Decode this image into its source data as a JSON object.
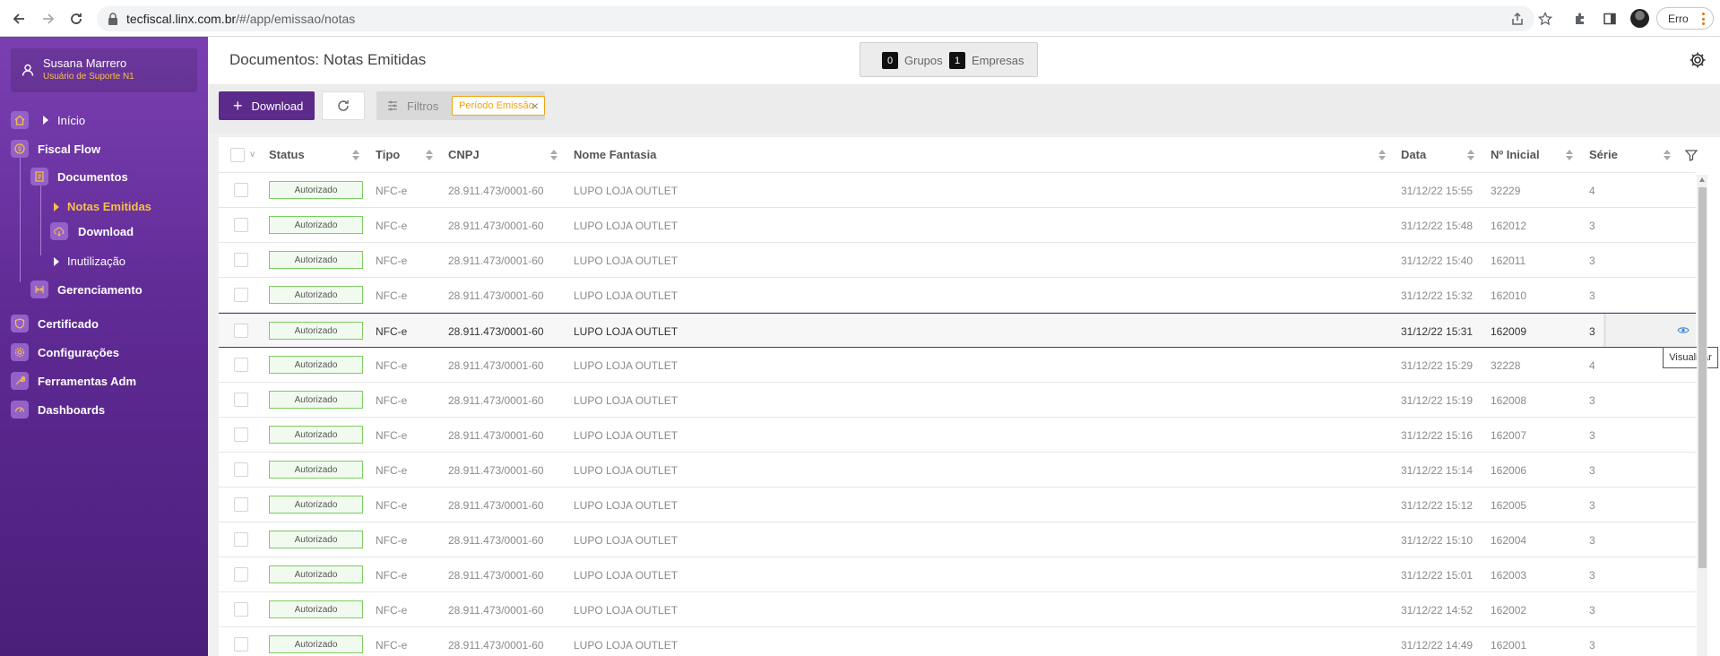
{
  "browser": {
    "url_host": "tecfiscal.linx.com.br",
    "url_path": "/#/app/emissao/notas",
    "profile_button": "Erro"
  },
  "sidebar": {
    "user": {
      "name": "Susana Marrero",
      "role": "Usuário de Suporte N1"
    },
    "items": [
      {
        "label": "Início"
      },
      {
        "label": "Fiscal Flow"
      },
      {
        "label": "Documentos"
      },
      {
        "label": "Notas Emitidas"
      },
      {
        "label": "Download"
      },
      {
        "label": "Inutilização"
      },
      {
        "label": "Gerenciamento"
      },
      {
        "label": "Certificado"
      },
      {
        "label": "Configurações"
      },
      {
        "label": "Ferramentas Adm"
      },
      {
        "label": "Dashboards"
      }
    ],
    "active_color": "#f5c04a",
    "background": "#6a309f"
  },
  "header": {
    "title": "Documentos: Notas Emitidas",
    "grupos_count": "0",
    "grupos_label": "Grupos",
    "empresas_count": "1",
    "empresas_label": "Empresas"
  },
  "toolbar": {
    "download_label": "Download",
    "filters_label": "Filtros",
    "chip_label": "Período Emissão",
    "chip_close": "×"
  },
  "table": {
    "columns": [
      "Status",
      "Tipo",
      "CNPJ",
      "Nome Fantasia",
      "Data",
      "Nº Inicial",
      "Série"
    ],
    "rows": [
      {
        "status": "Autorizado",
        "tipo": "NFC-e",
        "cnpj": "28.911.473/0001-60",
        "nome": "LUPO LOJA OUTLET",
        "data": "31/12/22 15:55",
        "inicial": "32229",
        "serie": "4"
      },
      {
        "status": "Autorizado",
        "tipo": "NFC-e",
        "cnpj": "28.911.473/0001-60",
        "nome": "LUPO LOJA OUTLET",
        "data": "31/12/22 15:48",
        "inicial": "162012",
        "serie": "3"
      },
      {
        "status": "Autorizado",
        "tipo": "NFC-e",
        "cnpj": "28.911.473/0001-60",
        "nome": "LUPO LOJA OUTLET",
        "data": "31/12/22 15:40",
        "inicial": "162011",
        "serie": "3"
      },
      {
        "status": "Autorizado",
        "tipo": "NFC-e",
        "cnpj": "28.911.473/0001-60",
        "nome": "LUPO LOJA OUTLET",
        "data": "31/12/22 15:32",
        "inicial": "162010",
        "serie": "3"
      },
      {
        "status": "Autorizado",
        "tipo": "NFC-e",
        "cnpj": "28.911.473/0001-60",
        "nome": "LUPO LOJA OUTLET",
        "data": "31/12/22 15:31",
        "inicial": "162009",
        "serie": "3"
      },
      {
        "status": "Autorizado",
        "tipo": "NFC-e",
        "cnpj": "28.911.473/0001-60",
        "nome": "LUPO LOJA OUTLET",
        "data": "31/12/22 15:29",
        "inicial": "32228",
        "serie": "4"
      },
      {
        "status": "Autorizado",
        "tipo": "NFC-e",
        "cnpj": "28.911.473/0001-60",
        "nome": "LUPO LOJA OUTLET",
        "data": "31/12/22 15:19",
        "inicial": "162008",
        "serie": "3"
      },
      {
        "status": "Autorizado",
        "tipo": "NFC-e",
        "cnpj": "28.911.473/0001-60",
        "nome": "LUPO LOJA OUTLET",
        "data": "31/12/22 15:16",
        "inicial": "162007",
        "serie": "3"
      },
      {
        "status": "Autorizado",
        "tipo": "NFC-e",
        "cnpj": "28.911.473/0001-60",
        "nome": "LUPO LOJA OUTLET",
        "data": "31/12/22 15:14",
        "inicial": "162006",
        "serie": "3"
      },
      {
        "status": "Autorizado",
        "tipo": "NFC-e",
        "cnpj": "28.911.473/0001-60",
        "nome": "LUPO LOJA OUTLET",
        "data": "31/12/22 15:12",
        "inicial": "162005",
        "serie": "3"
      },
      {
        "status": "Autorizado",
        "tipo": "NFC-e",
        "cnpj": "28.911.473/0001-60",
        "nome": "LUPO LOJA OUTLET",
        "data": "31/12/22 15:10",
        "inicial": "162004",
        "serie": "3"
      },
      {
        "status": "Autorizado",
        "tipo": "NFC-e",
        "cnpj": "28.911.473/0001-60",
        "nome": "LUPO LOJA OUTLET",
        "data": "31/12/22 15:01",
        "inicial": "162003",
        "serie": "3"
      },
      {
        "status": "Autorizado",
        "tipo": "NFC-e",
        "cnpj": "28.911.473/0001-60",
        "nome": "LUPO LOJA OUTLET",
        "data": "31/12/22 14:52",
        "inicial": "162002",
        "serie": "3"
      },
      {
        "status": "Autorizado",
        "tipo": "NFC-e",
        "cnpj": "28.911.473/0001-60",
        "nome": "LUPO LOJA OUTLET",
        "data": "31/12/22 14:49",
        "inicial": "162001",
        "serie": "3"
      }
    ],
    "tooltip": "Visualizar"
  },
  "colors": {
    "primary": "#5c2a8a",
    "status_border": "#7ccc63",
    "chip_accent": "#f2a20c",
    "eye_icon": "#4a90d9"
  }
}
